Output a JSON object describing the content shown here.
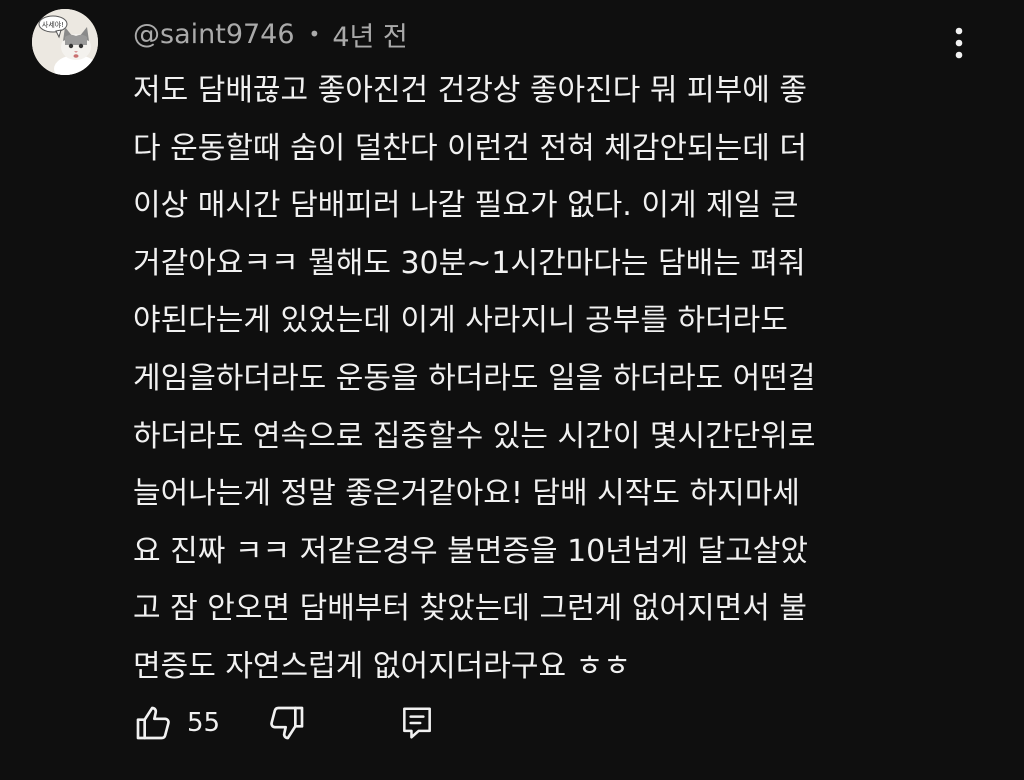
{
  "comment": {
    "author": "@saint9746",
    "separator": "•",
    "timestamp": "4년 전",
    "avatar_text": "사세야!",
    "lines": [
      "저도 담배끊고 좋아진건 건강상 좋아진다 뭐 피부에 좋",
      "다 운동할때 숨이 덜찬다 이런건 전혀 체감안되는데 더",
      "이상 매시간 담배피러 나갈 필요가 없다. 이게 제일 큰",
      "거같아요ㅋㅋ 뭘해도 30분~1시간마다는 담배는 펴줘",
      "야된다는게 있었는데 이게 사라지니 공부를 하더라도",
      "게임을하더라도 운동을 하더라도 일을 하더라도 어떤걸",
      "하더라도 연속으로 집중할수 있는 시간이 몇시간단위로",
      "늘어나는게 정말 좋은거같아요! 담배 시작도 하지마세",
      "요 진짜 ㅋㅋ 저같은경우 불면증을 10년넘게 달고살았",
      "고 잠 안오면 담배부터 찾았는데 그런게 없어지면서 불",
      "면증도 자연스럽게 없어지더라구요 ㅎㅎ"
    ],
    "like_count": "55"
  },
  "icons": {
    "like": "thumbs-up-icon",
    "dislike": "thumbs-down-icon",
    "reply": "comment-icon",
    "more": "more-vertical-icon"
  },
  "colors": {
    "background": "#0f0f0f",
    "text": "#f1f1f1",
    "secondary_text": "#aaaaaa"
  }
}
